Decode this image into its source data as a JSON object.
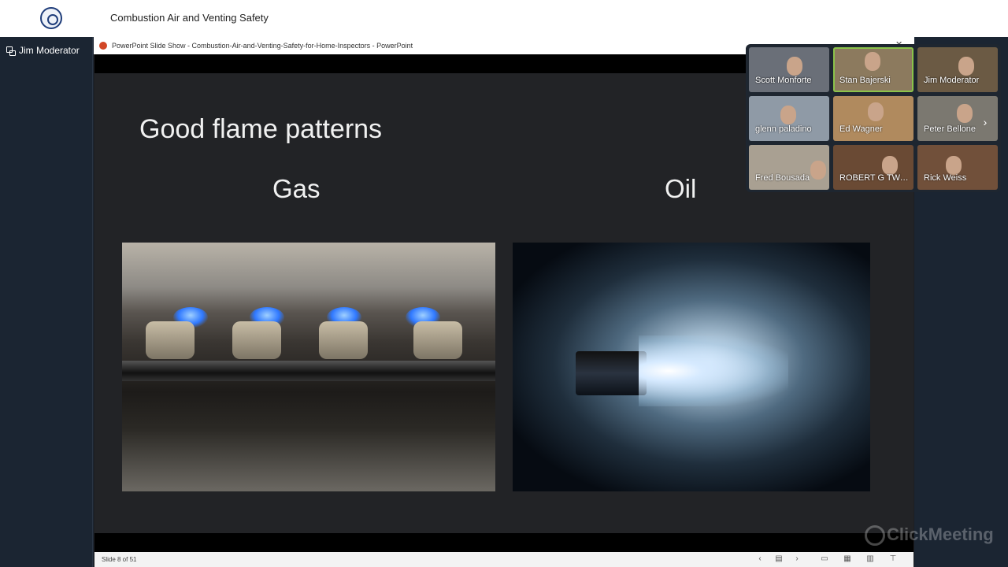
{
  "app": {
    "title": "Combustion Air and Venting Safety"
  },
  "left_panel": {
    "presenter_name": "Jim Moderator"
  },
  "powerpoint": {
    "window_title": "PowerPoint Slide Show  -  Combustion-Air-and-Venting-Safety-for-Home-Inspectors - PowerPoint",
    "close_glyph": "✕",
    "status": {
      "slide_counter": "Slide 8 of 51"
    }
  },
  "slide": {
    "title": "Good flame patterns",
    "left_heading": "Gas",
    "right_heading": "Oil"
  },
  "participants": [
    {
      "name": "Scott Monforte",
      "active": false,
      "bg": "#6a6f78"
    },
    {
      "name": "Stan Bajerski",
      "active": true,
      "bg": "#8c7a5e"
    },
    {
      "name": "Jim Moderator",
      "active": false,
      "bg": "#6b5a44"
    },
    {
      "name": "glenn paladino",
      "active": false,
      "bg": "#8f9aa6"
    },
    {
      "name": "Ed Wagner",
      "active": false,
      "bg": "#b08a5e"
    },
    {
      "name": "Peter Bellone",
      "active": false,
      "bg": "#7b7870"
    },
    {
      "name": "Fred Bousada",
      "active": false,
      "bg": "#a9a092"
    },
    {
      "name": "ROBERT G TWA...",
      "active": false,
      "bg": "#6a4a34"
    },
    {
      "name": "Rick Weiss",
      "active": false,
      "bg": "#71503a"
    }
  ],
  "watermark": {
    "text": "ClickMeeting"
  },
  "colors": {
    "active_speaker": "#8bc34a",
    "background": "#1c2430"
  }
}
